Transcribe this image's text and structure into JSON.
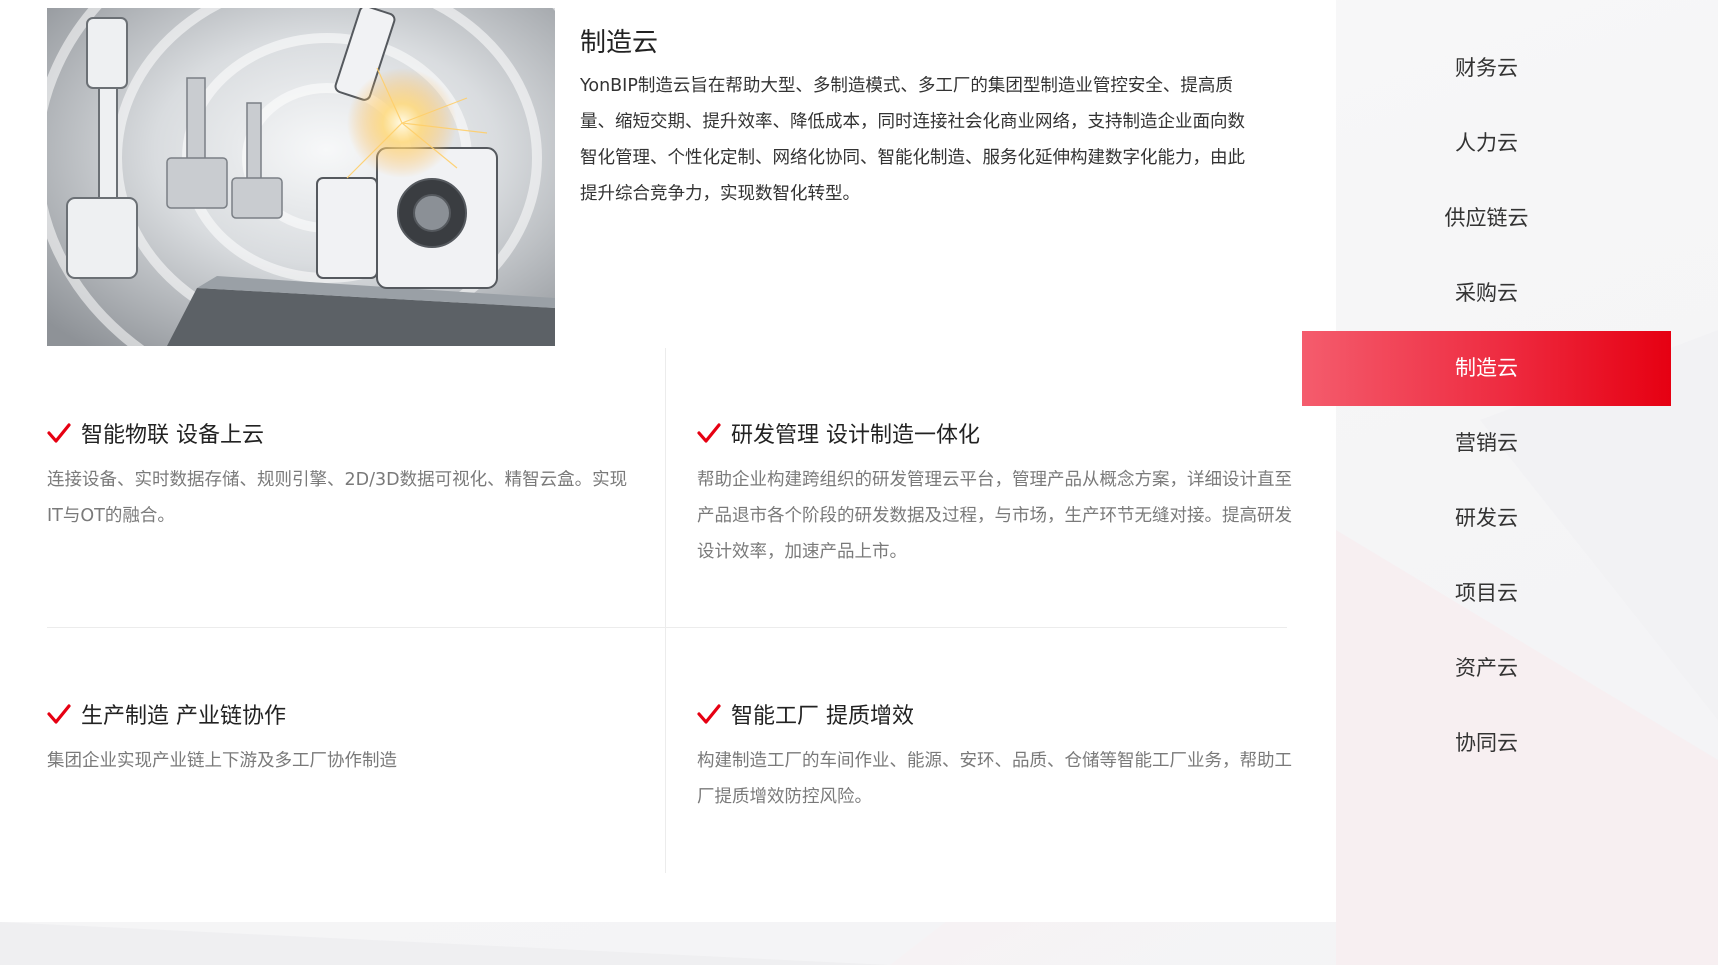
{
  "intro": {
    "title": "制造云",
    "description": "YonBIP制造云旨在帮助大型、多制造模式、多工厂的集团型制造业管控安全、提高质量、缩短交期、提升效率、降低成本，同时连接社会化商业网络，支持制造企业面向数智化管理、个性化定制、网络化协同、智能化制造、服务化延伸构建数字化能力，由此提升综合竞争力，实现数智化转型。"
  },
  "features": [
    {
      "title": "智能物联 设备上云",
      "desc": "连接设备、实时数据存储、规则引擎、2D/3D数据可视化、精智云盒。实现IT与OT的融合。"
    },
    {
      "title": "研发管理 设计制造一体化",
      "desc": "帮助企业构建跨组织的研发管理云平台，管理产品从概念方案，详细设计直至产品退市各个阶段的研发数据及过程，与市场，生产环节无缝对接。提高研发设计效率，加速产品上市。"
    },
    {
      "title": "生产制造 产业链协作",
      "desc": "集团企业实现产业链上下游及多工厂协作制造"
    },
    {
      "title": "智能工厂 提质增效",
      "desc": "构建制造工厂的车间作业、能源、安环、品质、仓储等智能工厂业务，帮助工厂提质增效防控风险。"
    }
  ],
  "nav": {
    "items": [
      {
        "label": "财务云"
      },
      {
        "label": "人力云"
      },
      {
        "label": "供应链云"
      },
      {
        "label": "采购云"
      },
      {
        "label": "制造云"
      },
      {
        "label": "营销云"
      },
      {
        "label": "研发云"
      },
      {
        "label": "项目云"
      },
      {
        "label": "资产云"
      },
      {
        "label": "协同云"
      }
    ],
    "active_index": 4
  },
  "colors": {
    "accent": "#e60012",
    "accent_light": "#f45c6d",
    "check": "#e60012"
  },
  "icons": {
    "check": "check-icon"
  }
}
